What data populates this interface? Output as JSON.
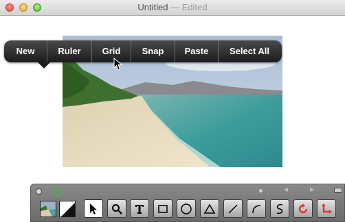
{
  "window": {
    "title": "Untitled",
    "status": "— Edited"
  },
  "context_menu": {
    "items": [
      "New",
      "Ruler",
      "Grid",
      "Snap",
      "Paste",
      "Select All"
    ]
  },
  "tool_palette": {
    "tools": [
      "arrow-tool",
      "zoom-tool",
      "text-tool",
      "rectangle-tool",
      "ellipse-tool",
      "triangle-tool",
      "line-tool",
      "arc-tool",
      "curve-tool",
      "rotate-tool",
      "crop-tool"
    ],
    "selected_tool": "arrow-tool"
  }
}
